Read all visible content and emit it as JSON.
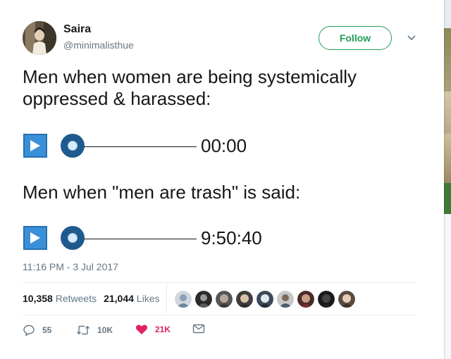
{
  "user": {
    "display_name": "Saira",
    "handle": "@minimalisthue",
    "avatar_icon": "profile-photo"
  },
  "follow_label": "Follow",
  "tweet": {
    "line1": "Men when women are being systemically",
    "line2": "oppressed & harassed:",
    "player1_time": "00:00",
    "player1_progress": 0,
    "line3": "Men when \"men are trash\" is said:",
    "player2_time": "9:50:40",
    "player2_progress": 0
  },
  "timestamp": "11:16 PM - 3 Jul 2017",
  "stats": {
    "retweets_count": "10,358",
    "retweets_label": "Retweets",
    "likes_count": "21,044",
    "likes_label": "Likes"
  },
  "actions": {
    "reply_count": "55",
    "retweet_count": "10K",
    "like_count": "21K"
  },
  "colors": {
    "follow_green": "#1f9d55",
    "play_blue": "#3a8fd9",
    "knob_blue": "#1f5a8e",
    "like_red": "#e0245e",
    "muted": "#657786"
  }
}
